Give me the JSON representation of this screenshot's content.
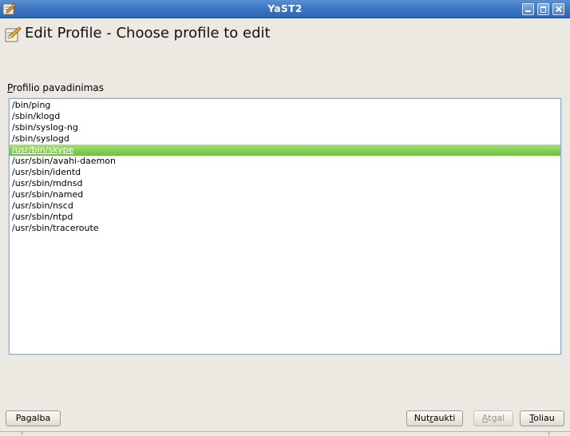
{
  "window": {
    "title": "YaST2",
    "controls": [
      "minimize-icon",
      "maximize-icon",
      "close-icon"
    ]
  },
  "header": {
    "icon": "edit-pencil-icon",
    "title": "Edit Profile - Choose profile to edit"
  },
  "list": {
    "label_mnemonic": "P",
    "label_rest": "rofilio pavadinimas",
    "items": [
      "/bin/ping",
      "/sbin/klogd",
      "/sbin/syslog-ng",
      "/sbin/syslogd",
      "/usr/bin/skype",
      "/usr/sbin/avahi-daemon",
      "/usr/sbin/identd",
      "/usr/sbin/mdnsd",
      "/usr/sbin/named",
      "/usr/sbin/nscd",
      "/usr/sbin/ntpd",
      "/usr/sbin/traceroute"
    ],
    "selected_index": 4
  },
  "buttons": {
    "help": "Pagalba",
    "cancel_pre": "Nut",
    "cancel_mn": "r",
    "cancel_post": "aukti",
    "back_pre": "",
    "back_mn": "A",
    "back_post": "tgal",
    "next_pre": "",
    "next_mn": "T",
    "next_post": "oliau"
  },
  "colors": {
    "titlebar": "#3e78c4",
    "selection": "#6cc03a",
    "background": "#ebe9e1"
  }
}
